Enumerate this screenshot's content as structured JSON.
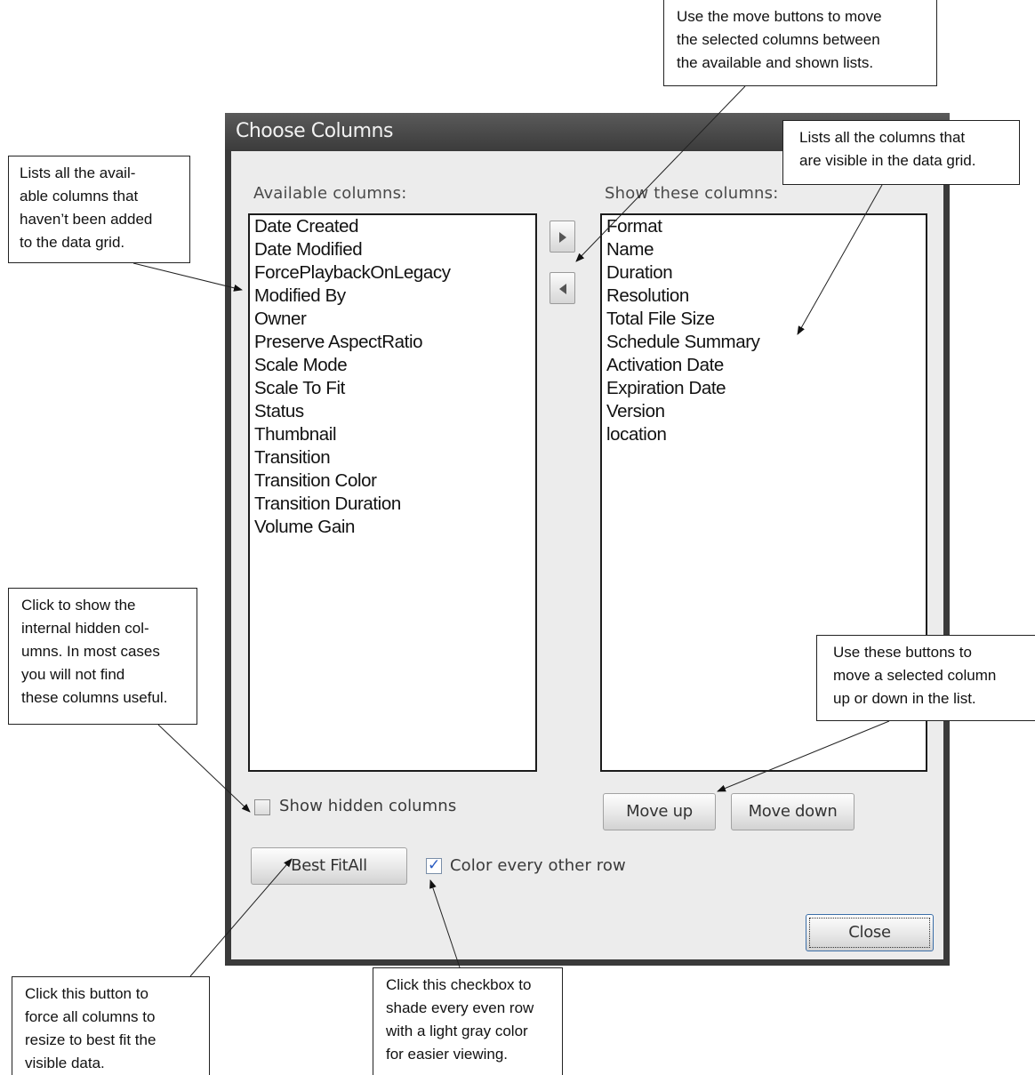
{
  "dialog": {
    "title": "Choose Columns",
    "available_label": "Available columns:",
    "shown_label": "Show these columns:",
    "available_columns": [
      "Date Created",
      "Date Modified",
      "ForcePlaybackOnLegacy",
      "Modified By",
      "Owner",
      "Preserve AspectRatio",
      "Scale Mode",
      "Scale To Fit",
      "Status",
      "Thumbnail",
      "Transition",
      "Transition Color",
      "Transition Duration",
      "Volume Gain"
    ],
    "shown_columns": [
      "Format",
      "Name",
      "Duration",
      "Resolution",
      "Total File Size",
      "Schedule Summary",
      "Activation Date",
      "Expiration Date",
      "Version",
      "location"
    ],
    "move_right_icon": "arrow-right-icon",
    "move_left_icon": "arrow-left-icon",
    "move_up_label": "Move up",
    "move_down_label": "Move down",
    "show_hidden_label": "Show hidden columns",
    "show_hidden_checked": false,
    "best_fit_label": "Best FitAll",
    "color_rows_label": "Color every other row",
    "color_rows_checked": true,
    "close_label": "Close"
  },
  "callouts": {
    "move_buttons": [
      "Use the move buttons to move",
      "the selected columns between",
      "the available and shown lists."
    ],
    "shown_list": [
      "Lists all the columns that",
      "are visible in the data grid."
    ],
    "available_list": [
      "Lists all the avail-",
      "able columns that",
      "haven’t been added",
      "to the data grid."
    ],
    "hidden_columns": [
      "Click to show the",
      "internal hidden col-",
      "umns. In most cases",
      "you will not find",
      "these columns useful."
    ],
    "up_down": [
      "Use these buttons to",
      "move a selected column",
      "up or down in the list."
    ],
    "best_fit": [
      "Click this button to",
      "force all columns to",
      "resize to best fit the",
      "visible data."
    ],
    "color_rows": [
      "Click this checkbox to",
      "shade every even row",
      "with a light gray color",
      "for easier viewing."
    ]
  },
  "colors": {
    "dialog_frame": "#3a3a3a",
    "dialog_client": "#ececec",
    "checkmark": "#2a5bc2"
  }
}
